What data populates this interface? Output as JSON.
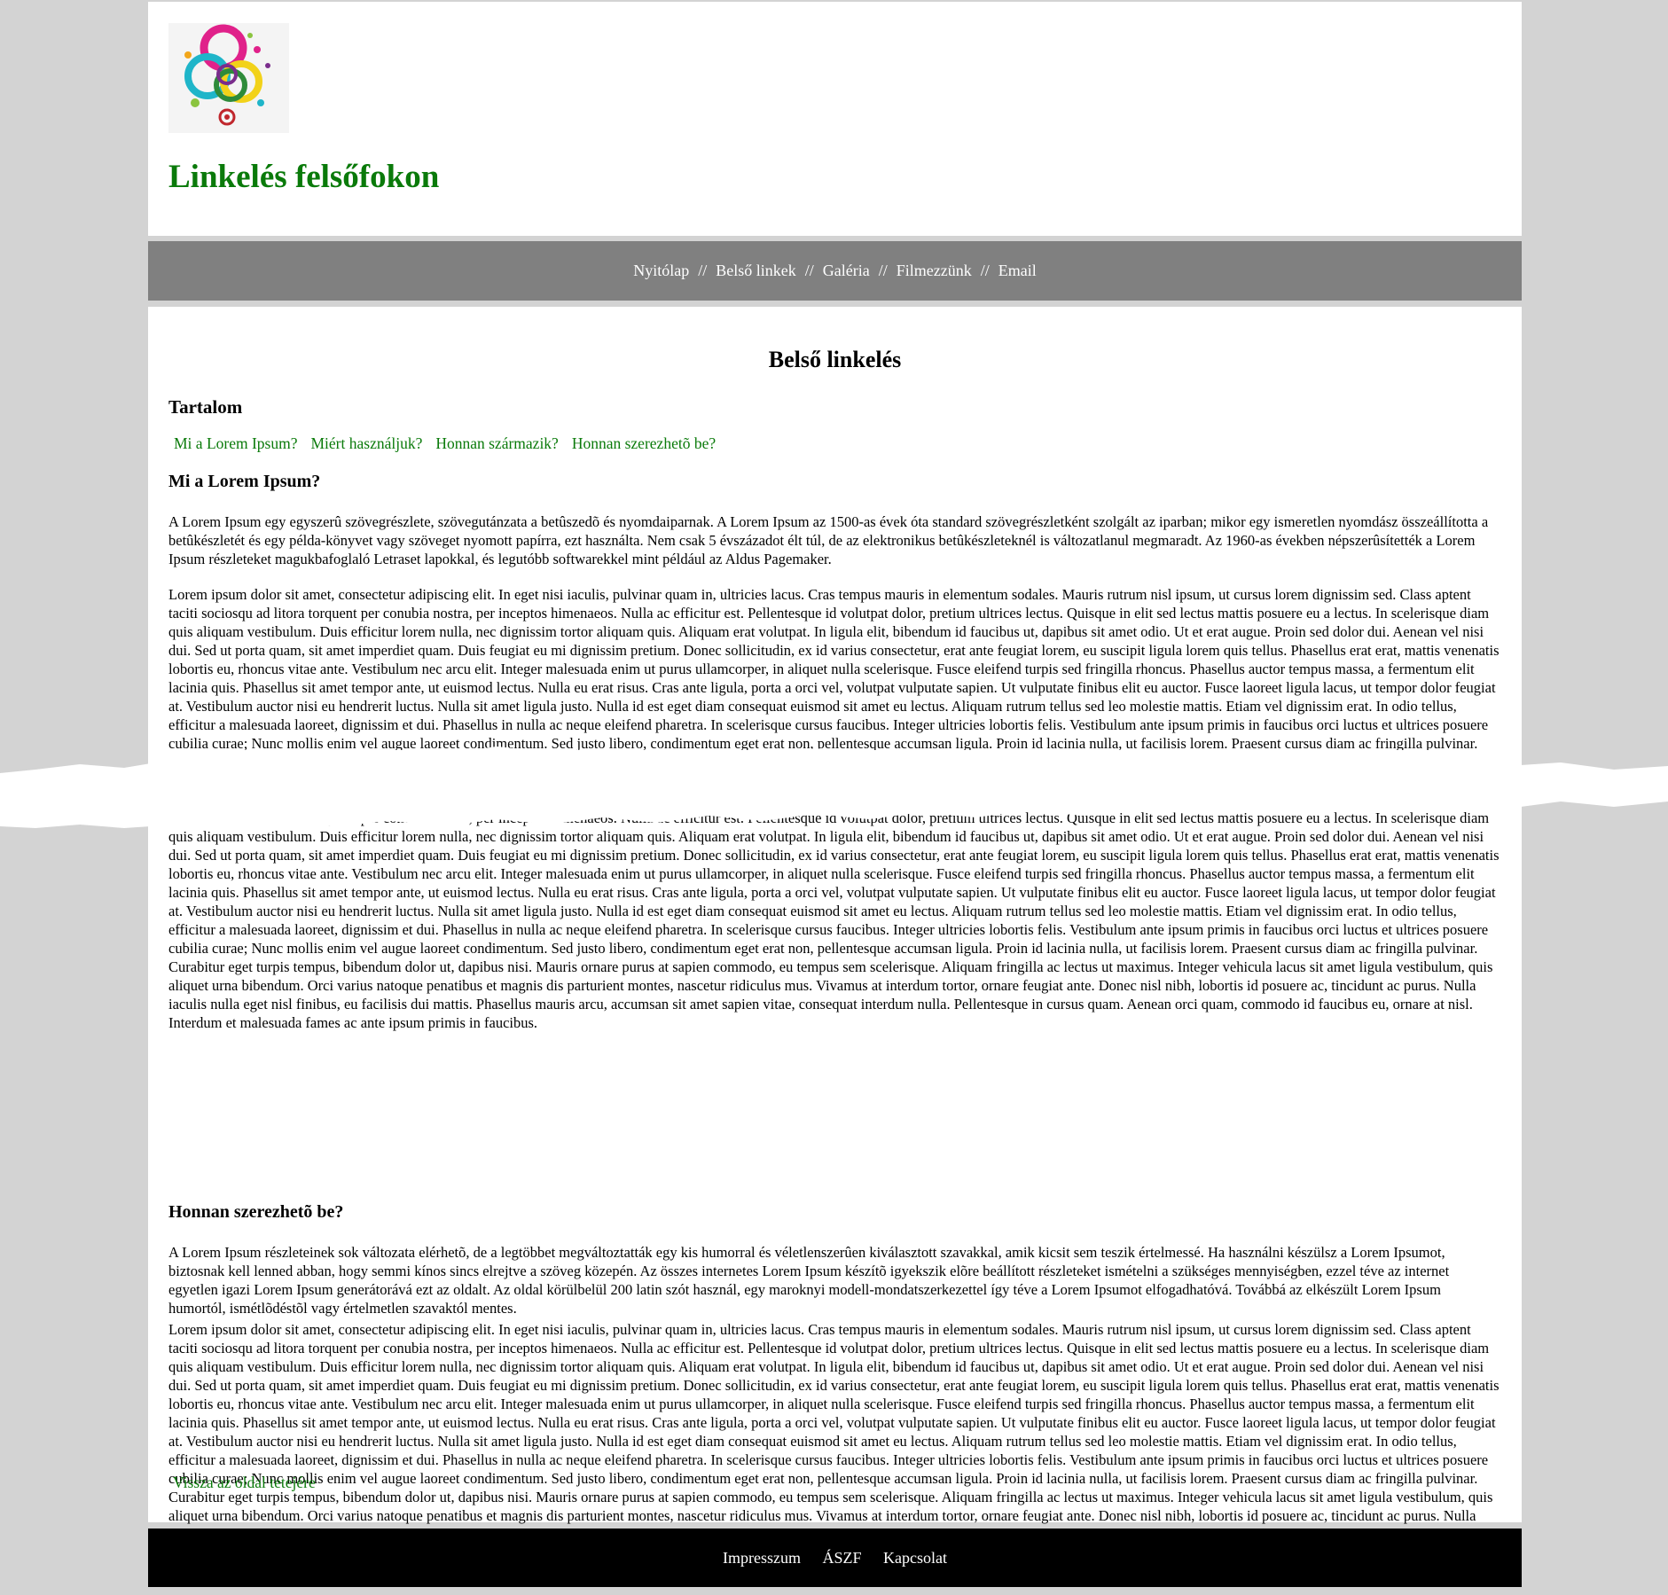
{
  "header": {
    "title": "Linkelés felsőfokon",
    "logo_icon": "colorful-circles-logo-icon"
  },
  "nav": {
    "items": [
      "Nyitólap",
      "Belső linkek",
      "Galéria",
      "Filmezzünk",
      "Email"
    ],
    "separator": "//"
  },
  "main": {
    "page_title": "Belső linkelés",
    "toc": {
      "title": "Tartalom",
      "links": [
        "Mi a Lorem Ipsum?",
        "Miért használjuk?",
        "Honnan származik?",
        "Honnan szerezhetõ be?"
      ]
    },
    "section1": {
      "heading": "Mi a Lorem Ipsum?",
      "para1": "A Lorem Ipsum egy egyszerû szövegrészlete, szövegutánzata a betûszedõ és nyomdaiparnak. A Lorem Ipsum az 1500-as évek óta standard szövegrészletként szolgált az iparban; mikor egy ismeretlen nyomdász összeállította a betûkészletét és egy példa-könyvet vagy szöveget nyomott papírra, ezt használta. Nem csak 5 évszázadot élt túl, de az elektronikus betûkészleteknél is változatlanul megmaradt. Az 1960-as években népszerûsítették a Lorem Ipsum részleteket magukbafoglaló Letraset lapokkal, és legutóbb softwarekkel mint például az Aldus Pagemaker.",
      "para2": "Lorem ipsum dolor sit amet, consectetur adipiscing elit. In eget nisi iaculis, pulvinar quam in, ultricies lacus. Cras tempus mauris in elementum sodales. Mauris rutrum nisl ipsum, ut cursus lorem dignissim sed. Class aptent taciti sociosqu ad litora torquent per conubia nostra, per inceptos himenaeos. Nulla ac efficitur est. Pellentesque id volutpat dolor, pretium ultrices lectus. Quisque in elit sed lectus mattis posuere eu a lectus. In scelerisque diam quis aliquam vestibulum. Duis efficitur lorem nulla, nec dignissim tortor aliquam quis. Aliquam erat volutpat. In ligula elit, bibendum id faucibus ut, dapibus sit amet odio. Ut et erat augue. Proin sed dolor dui. Aenean vel nisi dui. Sed ut porta quam, sit amet imperdiet quam. Duis feugiat eu mi dignissim pretium. Donec sollicitudin, ex id varius consectetur, erat ante feugiat lorem, eu suscipit ligula lorem quis tellus. Phasellus erat erat, mattis venenatis lobortis eu, rhoncus vitae ante. Vestibulum nec arcu elit. Integer malesuada enim ut purus ullamcorper, in aliquet nulla scelerisque. Fusce eleifend turpis sed fringilla rhoncus. Phasellus auctor tempus massa, a fermentum elit lacinia quis. Phasellus sit amet tempor ante, ut euismod lectus. Nulla eu erat risus. Cras ante ligula, porta a orci vel, volutpat vulputate sapien. Ut vulputate finibus elit eu auctor. Fusce laoreet ligula lacus, ut tempor dolor feugiat at. Vestibulum auctor nisi eu hendrerit luctus. Nulla sit amet ligula justo. Nulla id est eget diam consequat euismod sit amet eu lectus. Aliquam rutrum tellus sed leo molestie mattis. Etiam vel dignissim erat. In odio tellus, efficitur a malesuada laoreet, dignissim et dui. Phasellus in nulla ac neque eleifend pharetra. In scelerisque cursus faucibus. Integer ultricies lobortis felis. Vestibulum ante ipsum primis in faucibus orci luctus et ultrices posuere cubilia curae; Nunc mollis enim vel augue laoreet condimentum. Sed justo libero, condimentum eget erat non, pellentesque accumsan ligula. Proin id lacinia nulla, ut facilisis lorem. Praesent cursus diam ac fringilla pulvinar. Curabitur eget turpis tempus, bibendum dolor ut, dapibus nisi. Mauris ornare purus at sapien commodo, eu tempus sem scelerisque. Aliquam fringilla ac lectus ut maximus."
    },
    "section3": {
      "para": "Lorem ipsum dolor sit amet, consectetur adipiscing elit. In eget nisi iaculis, pulvinar quam in, ultricies lacus. Cras tempus mauris in elementum sodales. Mauris rutrum nisl ipsum, ut cursus lorem dignissim sed. Class aptent taciti sociosqu ad litora torquent per conubia nostra, per inceptos himenaeos. Nulla ac efficitur est. Pellentesque id volutpat dolor, pretium ultrices lectus. Quisque in elit sed lectus mattis posuere eu a lectus. In scelerisque diam quis aliquam vestibulum. Duis efficitur lorem nulla, nec dignissim tortor aliquam quis. Aliquam erat volutpat. In ligula elit, bibendum id faucibus ut, dapibus sit amet odio. Ut et erat augue. Proin sed dolor dui. Aenean vel nisi dui. Sed ut porta quam, sit amet imperdiet quam. Duis feugiat eu mi dignissim pretium. Donec sollicitudin, ex id varius consectetur, erat ante feugiat lorem, eu suscipit ligula lorem quis tellus. Phasellus erat erat, mattis venenatis lobortis eu, rhoncus vitae ante. Vestibulum nec arcu elit. Integer malesuada enim ut purus ullamcorper, in aliquet nulla scelerisque. Fusce eleifend turpis sed fringilla rhoncus. Phasellus auctor tempus massa, a fermentum elit lacinia quis. Phasellus sit amet tempor ante, ut euismod lectus. Nulla eu erat risus. Cras ante ligula, porta a orci vel, volutpat vulputate sapien. Ut vulputate finibus elit eu auctor. Fusce laoreet ligula lacus, ut tempor dolor feugiat at. Vestibulum auctor nisi eu hendrerit luctus. Nulla sit amet ligula justo. Nulla id est eget diam consequat euismod sit amet eu lectus. Aliquam rutrum tellus sed leo molestie mattis. Etiam vel dignissim erat. In odio tellus, efficitur a malesuada laoreet, dignissim et dui. Phasellus in nulla ac neque eleifend pharetra. In scelerisque cursus faucibus. Integer ultricies lobortis felis. Vestibulum ante ipsum primis in faucibus orci luctus et ultrices posuere cubilia curae; Nunc mollis enim vel augue laoreet condimentum. Sed justo libero, condimentum eget erat non, pellentesque accumsan ligula. Proin id lacinia nulla, ut facilisis lorem. Praesent cursus diam ac fringilla pulvinar. Curabitur eget turpis tempus, bibendum dolor ut, dapibus nisi. Mauris ornare purus at sapien commodo, eu tempus sem scelerisque. Aliquam fringilla ac lectus ut maximus. Integer vehicula lacus sit amet ligula vestibulum, quis aliquet urna bibendum. Orci varius natoque penatibus et magnis dis parturient montes, nascetur ridiculus mus. Vivamus at interdum tortor, ornare feugiat ante. Donec nisl nibh, lobortis id posuere ac, tincidunt ac purus. Nulla iaculis nulla eget nisl finibus, eu facilisis dui mattis. Phasellus mauris arcu, accumsan sit amet sapien vitae, consequat interdum nulla. Pellentesque in cursus quam. Aenean orci quam, commodo id faucibus eu, ornare at nisl. Interdum et malesuada fames ac ante ipsum primis in faucibus."
    },
    "section4": {
      "heading": "Honnan szerezhetõ be?",
      "para1": "A Lorem Ipsum részleteinek sok változata elérhetõ, de a legtöbbet megváltoztatták egy kis humorral és véletlenszerûen kiválasztott szavakkal, amik kicsit sem teszik értelmessé. Ha használni készülsz a Lorem Ipsumot, biztosnak kell lenned abban, hogy semmi kínos sincs elrejtve a szöveg közepén. Az összes internetes Lorem Ipsum készítõ igyekszik elõre beállított részleteket ismételni a szükséges mennyiségben, ezzel téve az internet egyetlen igazi Lorem Ipsum generátorává ezt az oldalt. Az oldal körülbelül 200 latin szót használ, egy maroknyi modell-mondatszerkezettel így téve a Lorem Ipsumot elfogadhatóvá. Továbbá az elkészült Lorem Ipsum humortól, ismétlõdéstõl vagy értelmetlen szavaktól mentes.",
      "para2": "Lorem ipsum dolor sit amet, consectetur adipiscing elit. In eget nisi iaculis, pulvinar quam in, ultricies lacus. Cras tempus mauris in elementum sodales. Mauris rutrum nisl ipsum, ut cursus lorem dignissim sed. Class aptent taciti sociosqu ad litora torquent per conubia nostra, per inceptos himenaeos. Nulla ac efficitur est. Pellentesque id volutpat dolor, pretium ultrices lectus. Quisque in elit sed lectus mattis posuere eu a lectus. In scelerisque diam quis aliquam vestibulum. Duis efficitur lorem nulla, nec dignissim tortor aliquam quis. Aliquam erat volutpat. In ligula elit, bibendum id faucibus ut, dapibus sit amet odio. Ut et erat augue. Proin sed dolor dui. Aenean vel nisi dui. Sed ut porta quam, sit amet imperdiet quam. Duis feugiat eu mi dignissim pretium. Donec sollicitudin, ex id varius consectetur, erat ante feugiat lorem, eu suscipit ligula lorem quis tellus. Phasellus erat erat, mattis venenatis lobortis eu, rhoncus vitae ante. Vestibulum nec arcu elit. Integer malesuada enim ut purus ullamcorper, in aliquet nulla scelerisque. Fusce eleifend turpis sed fringilla rhoncus. Phasellus auctor tempus massa, a fermentum elit lacinia quis. Phasellus sit amet tempor ante, ut euismod lectus. Nulla eu erat risus. Cras ante ligula, porta a orci vel, volutpat vulputate sapien. Ut vulputate finibus elit eu auctor. Fusce laoreet ligula lacus, ut tempor dolor feugiat at. Vestibulum auctor nisi eu hendrerit luctus. Nulla sit amet ligula justo. Nulla id est eget diam consequat euismod sit amet eu lectus. Aliquam rutrum tellus sed leo molestie mattis. Etiam vel dignissim erat. In odio tellus, efficitur a malesuada laoreet, dignissim et dui. Phasellus in nulla ac neque eleifend pharetra. In scelerisque cursus faucibus. Integer ultricies lobortis felis. Vestibulum ante ipsum primis in faucibus orci luctus et ultrices posuere cubilia curae; Nunc mollis enim vel augue laoreet condimentum. Sed justo libero, condimentum eget erat non, pellentesque accumsan ligula. Proin id lacinia nulla, ut facilisis lorem. Praesent cursus diam ac fringilla pulvinar. Curabitur eget turpis tempus, bibendum dolor ut, dapibus nisi. Mauris ornare purus at sapien commodo, eu tempus sem scelerisque. Aliquam fringilla ac lectus ut maximus. Integer vehicula lacus sit amet ligula vestibulum, quis aliquet urna bibendum. Orci varius natoque penatibus et magnis dis parturient montes, nascetur ridiculus mus. Vivamus at interdum tortor, ornare feugiat ante. Donec nisl nibh, lobortis id posuere ac, tincidunt ac purus. Nulla iaculis nulla eget nisl finibus, eu facilisis dui mattis. Phasellus mauris arcu, accumsan sit amet sapien vitae, consequat interdum nulla. Pellentesque in cursus quam. Aenean orci quam, commodo id faucibus eu, ornare at nisl. Interdum et malesuada fames ac ante ipsum primis in faucibus."
    },
    "back_to_top": "Vissza az oldal tetejére"
  },
  "footer": {
    "links": [
      "Impresszum",
      "ÁSZF",
      "Kapcsolat"
    ]
  },
  "colors": {
    "background": "#d3d3d3",
    "link_green": "#0a7a0a",
    "nav_bg": "#808080",
    "footer_bg": "#000000"
  }
}
